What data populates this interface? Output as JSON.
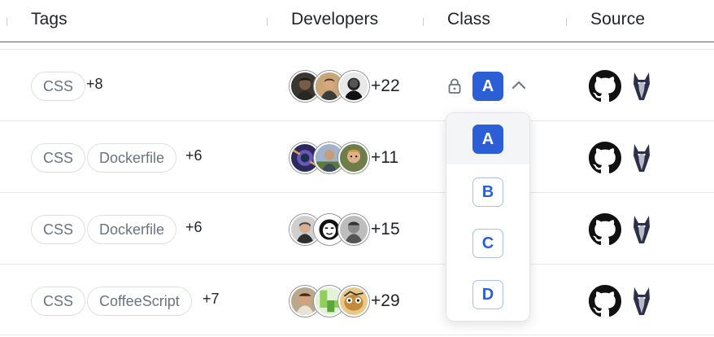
{
  "columns": {
    "tags": "Tags",
    "developers": "Developers",
    "class": "Class",
    "source": "Source"
  },
  "rows": [
    {
      "tags": [
        "CSS"
      ],
      "tags_more": "+8",
      "dev_count": "+22",
      "class": "A"
    },
    {
      "tags": [
        "CSS",
        "Dockerfile"
      ],
      "tags_more": "+6",
      "dev_count": "+11"
    },
    {
      "tags": [
        "CSS",
        "Dockerfile"
      ],
      "tags_more": "+6",
      "dev_count": "+15"
    },
    {
      "tags": [
        "CSS",
        "CoffeeScript"
      ],
      "tags_more": "+7",
      "dev_count": "+29"
    }
  ],
  "class_dropdown": {
    "options": [
      "A",
      "B",
      "C",
      "D"
    ],
    "selected": "A"
  },
  "icons": {
    "lock": "lock-icon",
    "chevron": "chevron-up-icon",
    "github": "github-icon",
    "source2": "doberman-icon"
  },
  "colors": {
    "accent": "#2c5ed6",
    "chip_border": "#dcdfe3",
    "chip_text": "#6b7280"
  }
}
